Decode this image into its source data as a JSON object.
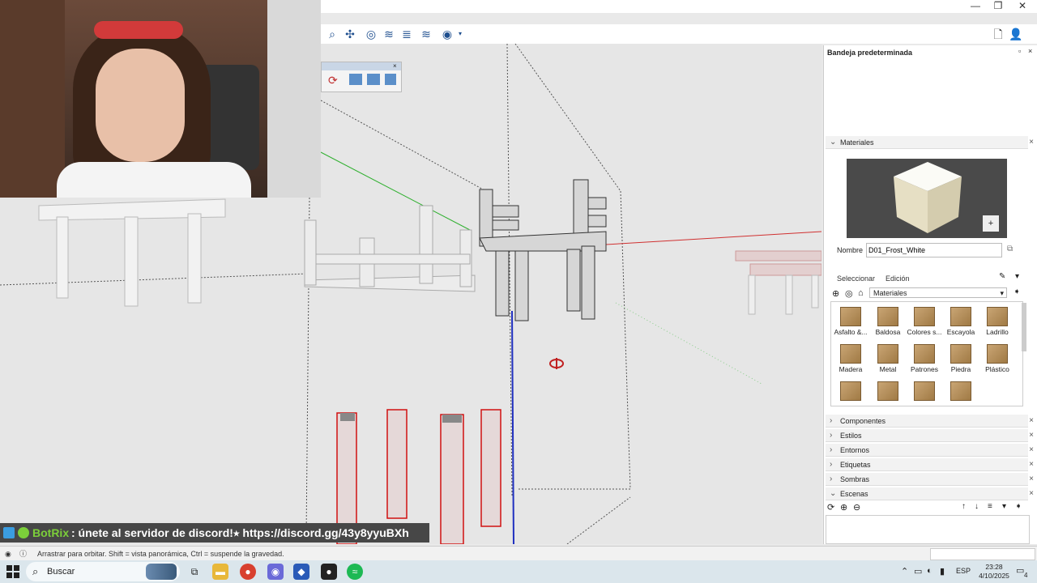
{
  "window": {
    "minimize": "—",
    "restore": "❐",
    "close": "✕"
  },
  "tray": {
    "title": "Bandeja predeterminada",
    "materials": {
      "header": "Materiales",
      "name_label": "Nombre",
      "name_value": "D01_Frost_White",
      "tab_select": "Seleccionar",
      "tab_edit": "Edición",
      "library_select": "Materiales",
      "items": [
        "Asfalto &...",
        "Baldosa",
        "Colores s...",
        "Escayola",
        "Ladrillo",
        "Madera",
        "Metal",
        "Patrones",
        "Piedra",
        "Plástico",
        "",
        "",
        "",
        ""
      ]
    },
    "sections": [
      "Componentes",
      "Estilos",
      "Entornos",
      "Etiquetas",
      "Sombras",
      "Escenas"
    ]
  },
  "banner": {
    "bot": "BotRix",
    "message": ": únete al servidor de discord!⭑ https://discord.gg/43y8yyuBXh"
  },
  "status": {
    "hint": "Arrastrar para orbitar. Shift = vista panorámica, Ctrl = suspende la gravedad."
  },
  "taskbar": {
    "search": "Buscar",
    "lang": "ESP",
    "time": "23:28",
    "date": "4/10/2025",
    "notif": "4"
  },
  "colors": {
    "accent": "#1f4f8f",
    "red_axis": "#d03030",
    "green_axis": "#30b030",
    "blue_axis": "#2030c0"
  }
}
